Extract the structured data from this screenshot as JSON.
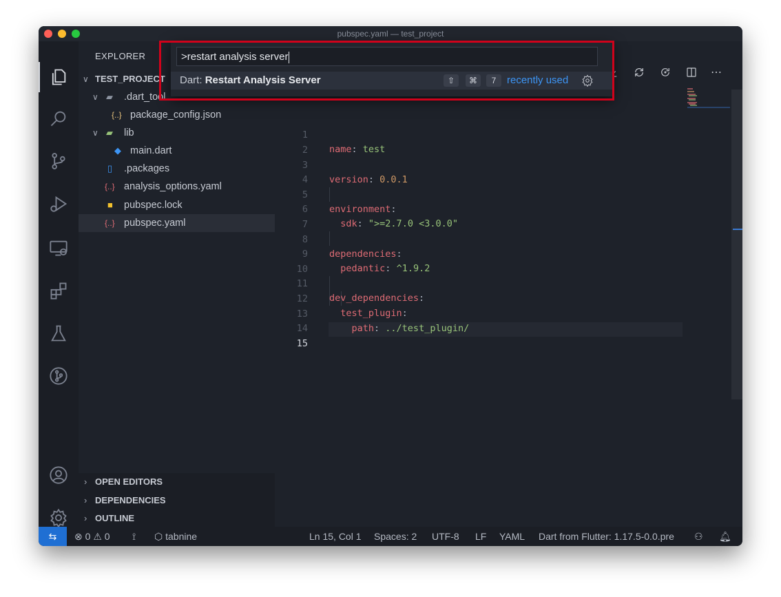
{
  "window": {
    "title": "pubspec.yaml — test_project"
  },
  "explorer": {
    "header": "EXPLORER",
    "root": "TEST_PROJECT",
    "tree": [
      {
        "label": ".dart_tool",
        "type": "folder"
      },
      {
        "label": "package_config.json",
        "type": "json"
      },
      {
        "label": "lib",
        "type": "folder"
      },
      {
        "label": "main.dart",
        "type": "dart"
      },
      {
        "label": ".packages",
        "type": "file"
      },
      {
        "label": "analysis_options.yaml",
        "type": "yaml"
      },
      {
        "label": "pubspec.lock",
        "type": "lock"
      },
      {
        "label": "pubspec.yaml",
        "type": "yaml",
        "selected": true
      }
    ],
    "sections": [
      "OPEN EDITORS",
      "DEPENDENCIES",
      "OUTLINE"
    ]
  },
  "palette": {
    "query": ">restart analysis server",
    "item_prefix": "Dart: ",
    "item_name": "Restart Analysis Server",
    "keys": [
      "⇧",
      "⌘",
      "7"
    ],
    "badge": "recently used"
  },
  "editor": {
    "line_numbers": [
      "1",
      "2",
      "3",
      "4",
      "5",
      "6",
      "7",
      "8",
      "9",
      "10",
      "11",
      "12",
      "13",
      "14",
      "15"
    ],
    "lines": [
      {
        "key": "name",
        "value": "test"
      },
      {
        "key": "version",
        "value": "0.0.1"
      },
      {
        "key": "environment"
      },
      {
        "key": "sdk",
        "value": "\">=2.7.0 <3.0.0\""
      },
      {
        "key": "dependencies"
      },
      {
        "key": "pedantic",
        "value": "^1.9.2"
      },
      {
        "key": "dev_dependencies"
      },
      {
        "key": "test_plugin"
      },
      {
        "key": "path",
        "value": "../test_plugin/"
      }
    ]
  },
  "statusbar": {
    "errors": "0",
    "warnings": "0",
    "tabnine": "tabnine",
    "position": "Ln 15, Col 1",
    "spaces": "Spaces: 2",
    "encoding": "UTF-8",
    "eol": "LF",
    "language": "YAML",
    "sdk": "Dart from Flutter: 1.17.5-0.0.pre"
  },
  "colors": {
    "accent": "#1f6fd3",
    "highlight_border": "#d0021b",
    "recently_used": "#3d95f5"
  }
}
